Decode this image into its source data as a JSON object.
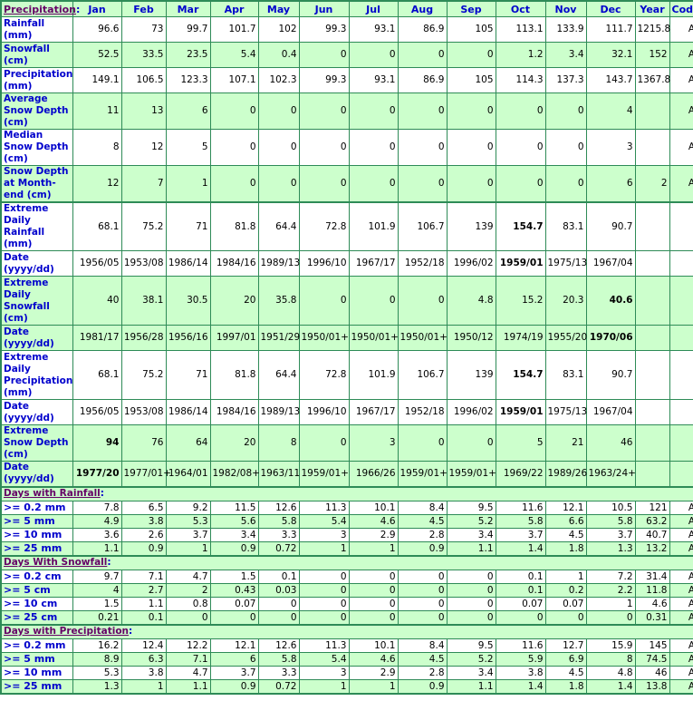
{
  "header": {
    "section_label": "Precipitation",
    "colon": ":",
    "columns": [
      "Jan",
      "Feb",
      "Mar",
      "Apr",
      "May",
      "Jun",
      "Jul",
      "Aug",
      "Sep",
      "Oct",
      "Nov",
      "Dec",
      "Year",
      "Code"
    ]
  },
  "colors": {
    "row_green": "#ccffcc",
    "border": "#2e8b57",
    "label_blue": "#0000cc",
    "section_link": "#660066"
  },
  "rows": [
    {
      "label": "Rainfall (mm)",
      "shade": "w",
      "values": [
        "96.6",
        "73",
        "99.7",
        "101.7",
        "102",
        "99.3",
        "93.1",
        "86.9",
        "105",
        "113.1",
        "133.9",
        "111.7",
        "1215.8",
        "A"
      ],
      "bold": []
    },
    {
      "label": "Snowfall (cm)",
      "shade": "g",
      "values": [
        "52.5",
        "33.5",
        "23.5",
        "5.4",
        "0.4",
        "0",
        "0",
        "0",
        "0",
        "1.2",
        "3.4",
        "32.1",
        "152",
        "A"
      ],
      "bold": []
    },
    {
      "label": "Precipitation (mm)",
      "shade": "w",
      "values": [
        "149.1",
        "106.5",
        "123.3",
        "107.1",
        "102.3",
        "99.3",
        "93.1",
        "86.9",
        "105",
        "114.3",
        "137.3",
        "143.7",
        "1367.8",
        "A"
      ],
      "bold": []
    },
    {
      "label": "Average Snow Depth (cm)",
      "shade": "g",
      "values": [
        "11",
        "13",
        "6",
        "0",
        "0",
        "0",
        "0",
        "0",
        "0",
        "0",
        "0",
        "4",
        "",
        "A"
      ],
      "bold": []
    },
    {
      "label": "Median Snow Depth (cm)",
      "shade": "w",
      "values": [
        "8",
        "12",
        "5",
        "0",
        "0",
        "0",
        "0",
        "0",
        "0",
        "0",
        "0",
        "3",
        "",
        "A"
      ],
      "bold": []
    },
    {
      "label": "Snow Depth at Month-end (cm)",
      "shade": "g",
      "values": [
        "12",
        "7",
        "1",
        "0",
        "0",
        "0",
        "0",
        "0",
        "0",
        "0",
        "0",
        "6",
        "2",
        "A"
      ],
      "bold": []
    },
    {
      "label": "Extreme Daily Rainfall (mm)",
      "shade": "w",
      "group_start": true,
      "values": [
        "68.1",
        "75.2",
        "71",
        "81.8",
        "64.4",
        "72.8",
        "101.9",
        "106.7",
        "139",
        "154.7",
        "83.1",
        "90.7",
        "",
        ""
      ],
      "bold": [
        9
      ]
    },
    {
      "label": "Date (yyyy/dd)",
      "shade": "w",
      "values": [
        "1956/05",
        "1953/08",
        "1986/14",
        "1984/16",
        "1989/13",
        "1996/10",
        "1967/17",
        "1952/18",
        "1996/02",
        "1959/01",
        "1975/13",
        "1967/04",
        "",
        ""
      ],
      "bold": [
        9
      ]
    },
    {
      "label": "Extreme Daily Snowfall (cm)",
      "shade": "g",
      "values": [
        "40",
        "38.1",
        "30.5",
        "20",
        "35.8",
        "0",
        "0",
        "0",
        "4.8",
        "15.2",
        "20.3",
        "40.6",
        "",
        ""
      ],
      "bold": [
        11
      ]
    },
    {
      "label": "Date (yyyy/dd)",
      "shade": "g",
      "values": [
        "1981/17",
        "1956/28",
        "1956/16",
        "1997/01",
        "1951/29",
        "1950/01+",
        "1950/01+",
        "1950/01+",
        "1950/12",
        "1974/19",
        "1955/20",
        "1970/06",
        "",
        ""
      ],
      "bold": [
        11
      ]
    },
    {
      "label": "Extreme Daily Precipitation (mm)",
      "shade": "w",
      "values": [
        "68.1",
        "75.2",
        "71",
        "81.8",
        "64.4",
        "72.8",
        "101.9",
        "106.7",
        "139",
        "154.7",
        "83.1",
        "90.7",
        "",
        ""
      ],
      "bold": [
        9
      ]
    },
    {
      "label": "Date (yyyy/dd)",
      "shade": "w",
      "values": [
        "1956/05",
        "1953/08",
        "1986/14",
        "1984/16",
        "1989/13",
        "1996/10",
        "1967/17",
        "1952/18",
        "1996/02",
        "1959/01",
        "1975/13",
        "1967/04",
        "",
        ""
      ],
      "bold": [
        9
      ]
    },
    {
      "label": "Extreme Snow Depth (cm)",
      "shade": "g",
      "values": [
        "94",
        "76",
        "64",
        "20",
        "8",
        "0",
        "3",
        "0",
        "0",
        "5",
        "21",
        "46",
        "",
        ""
      ],
      "bold": [
        0
      ]
    },
    {
      "label": "Date (yyyy/dd)",
      "shade": "g",
      "values": [
        "1977/20",
        "1977/01+",
        "1964/01",
        "1982/08+",
        "1963/11",
        "1959/01+",
        "1966/26",
        "1959/01+",
        "1959/01+",
        "1969/22",
        "1989/26",
        "1963/24+",
        "",
        ""
      ],
      "bold": [
        0
      ]
    }
  ],
  "sections": [
    {
      "title": "Days with Rainfall",
      "rows": [
        {
          "label": ">= 0.2 mm",
          "shade": "w",
          "values": [
            "7.8",
            "6.5",
            "9.2",
            "11.5",
            "12.6",
            "11.3",
            "10.1",
            "8.4",
            "9.5",
            "11.6",
            "12.1",
            "10.5",
            "121",
            "A"
          ]
        },
        {
          "label": ">= 5 mm",
          "shade": "g",
          "values": [
            "4.9",
            "3.8",
            "5.3",
            "5.6",
            "5.8",
            "5.4",
            "4.6",
            "4.5",
            "5.2",
            "5.8",
            "6.6",
            "5.8",
            "63.2",
            "A"
          ]
        },
        {
          "label": ">= 10 mm",
          "shade": "w",
          "values": [
            "3.6",
            "2.6",
            "3.7",
            "3.4",
            "3.3",
            "3",
            "2.9",
            "2.8",
            "3.4",
            "3.7",
            "4.5",
            "3.7",
            "40.7",
            "A"
          ]
        },
        {
          "label": ">= 25 mm",
          "shade": "g",
          "values": [
            "1.1",
            "0.9",
            "1",
            "0.9",
            "0.72",
            "1",
            "1",
            "0.9",
            "1.1",
            "1.4",
            "1.8",
            "1.3",
            "13.2",
            "A"
          ]
        }
      ]
    },
    {
      "title": "Days With Snowfall",
      "rows": [
        {
          "label": ">= 0.2 cm",
          "shade": "w",
          "values": [
            "9.7",
            "7.1",
            "4.7",
            "1.5",
            "0.1",
            "0",
            "0",
            "0",
            "0",
            "0.1",
            "1",
            "7.2",
            "31.4",
            "A"
          ]
        },
        {
          "label": ">= 5 cm",
          "shade": "g",
          "values": [
            "4",
            "2.7",
            "2",
            "0.43",
            "0.03",
            "0",
            "0",
            "0",
            "0",
            "0.1",
            "0.2",
            "2.2",
            "11.8",
            "A"
          ]
        },
        {
          "label": ">= 10 cm",
          "shade": "w",
          "values": [
            "1.5",
            "1.1",
            "0.8",
            "0.07",
            "0",
            "0",
            "0",
            "0",
            "0",
            "0.07",
            "0.07",
            "1",
            "4.6",
            "A"
          ]
        },
        {
          "label": ">= 25 cm",
          "shade": "g",
          "values": [
            "0.21",
            "0.1",
            "0",
            "0",
            "0",
            "0",
            "0",
            "0",
            "0",
            "0",
            "0",
            "0",
            "0.31",
            "A"
          ]
        }
      ]
    },
    {
      "title": "Days with Precipitation",
      "rows": [
        {
          "label": ">= 0.2 mm",
          "shade": "w",
          "values": [
            "16.2",
            "12.4",
            "12.2",
            "12.1",
            "12.6",
            "11.3",
            "10.1",
            "8.4",
            "9.5",
            "11.6",
            "12.7",
            "15.9",
            "145",
            "A"
          ]
        },
        {
          "label": ">= 5 mm",
          "shade": "g",
          "values": [
            "8.9",
            "6.3",
            "7.1",
            "6",
            "5.8",
            "5.4",
            "4.6",
            "4.5",
            "5.2",
            "5.9",
            "6.9",
            "8",
            "74.5",
            "A"
          ]
        },
        {
          "label": ">= 10 mm",
          "shade": "w",
          "values": [
            "5.3",
            "3.8",
            "4.7",
            "3.7",
            "3.3",
            "3",
            "2.9",
            "2.8",
            "3.4",
            "3.8",
            "4.5",
            "4.8",
            "46",
            "A"
          ]
        },
        {
          "label": ">= 25 mm",
          "shade": "g",
          "values": [
            "1.3",
            "1",
            "1.1",
            "0.9",
            "0.72",
            "1",
            "1",
            "0.9",
            "1.1",
            "1.4",
            "1.8",
            "1.4",
            "13.8",
            "A"
          ]
        }
      ]
    }
  ]
}
